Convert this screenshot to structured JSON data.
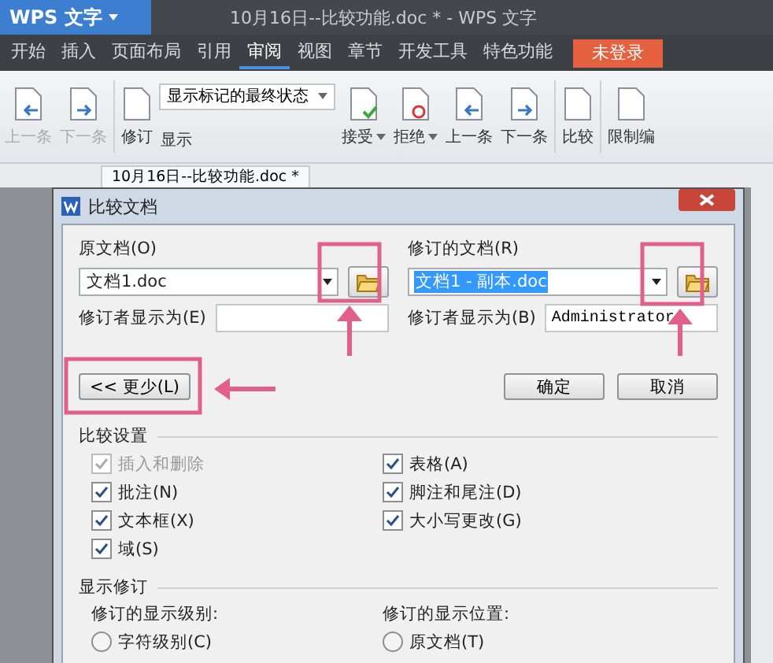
{
  "app_button": {
    "label": "WPS 文字"
  },
  "window": {
    "title": "10月16日--比较功能.doc * - WPS 文字"
  },
  "menu": [
    {
      "label": "开始",
      "selected": false
    },
    {
      "label": "插入",
      "selected": false
    },
    {
      "label": "页面布局",
      "selected": false
    },
    {
      "label": "引用",
      "selected": false
    },
    {
      "label": "审阅",
      "selected": true
    },
    {
      "label": "视图",
      "selected": false
    },
    {
      "label": "章节",
      "selected": false
    },
    {
      "label": "开发工具",
      "selected": false
    },
    {
      "label": "特色功能",
      "selected": false
    }
  ],
  "login_button": "未登录",
  "ribbon": {
    "left": [
      {
        "label": "上一条",
        "disabled": true
      },
      {
        "label": "下一条",
        "disabled": true
      }
    ],
    "revise": {
      "label": "修订"
    },
    "markup_combo": {
      "value": "显示标记的最终状态"
    },
    "show": {
      "label": "显示"
    },
    "right": [
      {
        "label": "接受",
        "dropdown": true
      },
      {
        "label": "拒绝",
        "dropdown": true
      },
      {
        "label": "上一条",
        "dropdown": false
      },
      {
        "label": "下一条",
        "dropdown": false
      }
    ],
    "compare": {
      "label": "比较"
    },
    "restrict": {
      "label": "限制编"
    }
  },
  "doc_tab": {
    "label": "10月16日--比较功能.doc *"
  },
  "dialog": {
    "title": "比较文档",
    "original": {
      "label": "原文档(O)",
      "value": "文档1.doc",
      "reviewer_label": "修订者显示为(E)"
    },
    "revised": {
      "label": "修订的文档(R)",
      "value": "文档1 - 副本.doc",
      "reviewer_label": "修订者显示为(B)",
      "reviewer_value": "Administrator"
    },
    "less_button": "<< 更少(L)",
    "ok_button": "确定",
    "cancel_button": "取消",
    "compare_settings": {
      "title": "比较设置",
      "options": [
        {
          "label": "插入和删除",
          "checked": true,
          "disabled": true
        },
        {
          "label": "表格(A)",
          "checked": true,
          "disabled": false
        },
        {
          "label": "批注(N)",
          "checked": true,
          "disabled": false
        },
        {
          "label": "脚注和尾注(D)",
          "checked": true,
          "disabled": false
        },
        {
          "label": "文本框(X)",
          "checked": true,
          "disabled": false
        },
        {
          "label": "大小写更改(G)",
          "checked": true,
          "disabled": false
        },
        {
          "label": "域(S)",
          "checked": true,
          "disabled": false
        }
      ]
    },
    "show_revisions": {
      "title": "显示修订",
      "level": {
        "label": "修订的显示级别:",
        "options": [
          {
            "label": "字符级别(C)",
            "selected": false
          }
        ]
      },
      "position": {
        "label": "修订的显示位置:",
        "options": [
          {
            "label": "原文档(T)",
            "selected": false
          }
        ]
      }
    }
  }
}
